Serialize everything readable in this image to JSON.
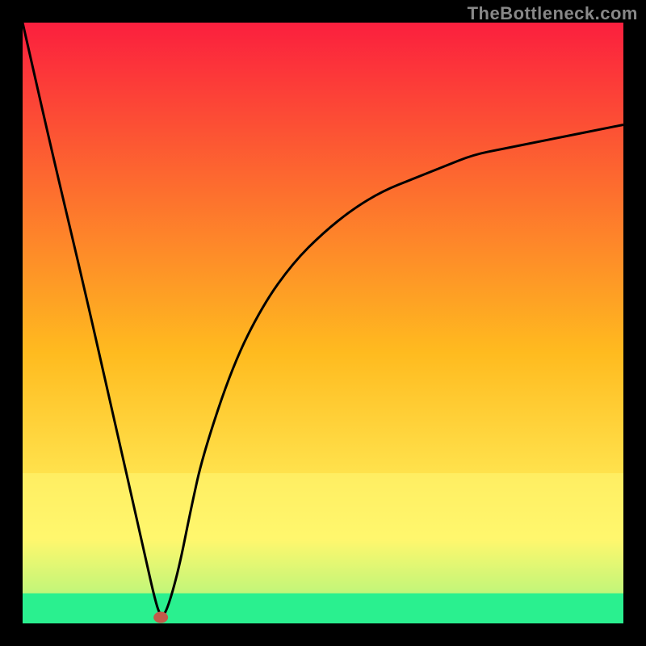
{
  "watermark": "TheBottleneck.com",
  "chart_data": {
    "type": "line",
    "title": "",
    "xlabel": "",
    "ylabel": "",
    "xlim": [
      0,
      100
    ],
    "ylim": [
      0,
      100
    ],
    "grid": false,
    "legend": false,
    "background_gradient": {
      "top_color": "#fb1f3e",
      "mid_color": "#ffbb1f",
      "lower_color": "#fff765",
      "bottom_color": "#2af08f"
    },
    "band_colors": {
      "yellow_band_y_range": [
        5,
        25
      ],
      "green_band_y_range": [
        0,
        5
      ]
    },
    "series": [
      {
        "name": "bottleneck-curve",
        "comment": "V-shaped curve: steep linear descent on the left, narrow trough near x≈23, then asymptotic rise toward y≈83 on the right",
        "x": [
          0,
          5,
          10,
          15,
          20,
          22,
          23,
          24,
          26,
          28,
          30,
          35,
          40,
          45,
          50,
          55,
          60,
          65,
          70,
          75,
          80,
          85,
          90,
          95,
          100
        ],
        "y": [
          100,
          78,
          57,
          35,
          13,
          4,
          1,
          2,
          9,
          19,
          28,
          43,
          53,
          60,
          65,
          69,
          72,
          74,
          76,
          78,
          79,
          80,
          81,
          82,
          83
        ]
      }
    ],
    "marker": {
      "name": "trough-marker",
      "x": 23,
      "y": 1,
      "color": "#c15a4a",
      "rx": 9,
      "ry": 7
    },
    "plot_outline_color": "#000000",
    "plot_outline_width": 28,
    "curve_stroke_color": "#000000",
    "curve_stroke_width": 3
  }
}
